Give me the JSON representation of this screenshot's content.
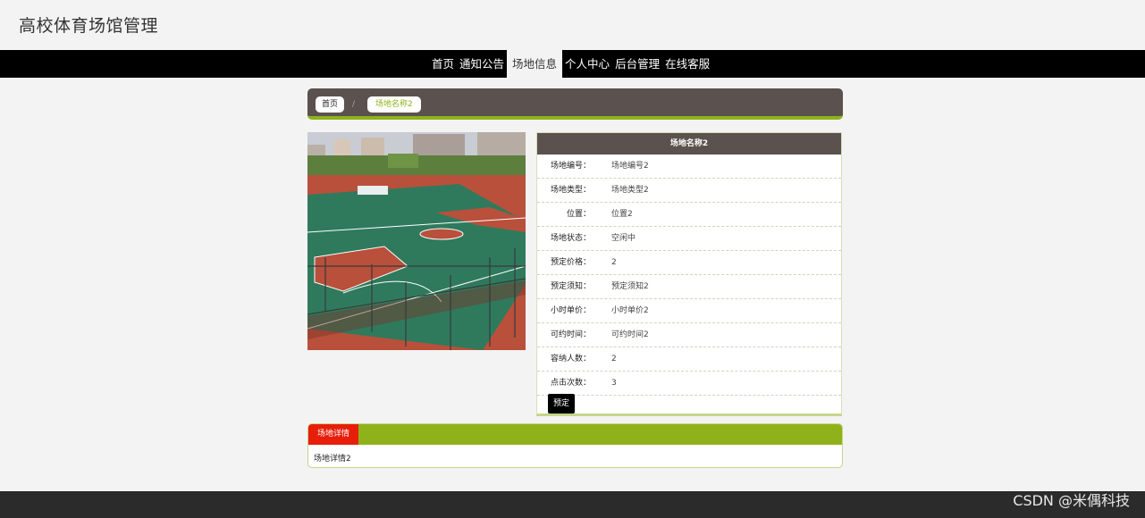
{
  "site": {
    "title": "高校体育场馆管理"
  },
  "nav": {
    "items": [
      {
        "label": "首页"
      },
      {
        "label": "通知公告"
      },
      {
        "label": "场地信息"
      },
      {
        "label": "个人中心"
      },
      {
        "label": "后台管理"
      },
      {
        "label": "在线客服"
      }
    ],
    "active_index": 2
  },
  "breadcrumb": {
    "home": "首页",
    "separator": "/",
    "current": "场地名称2"
  },
  "venue": {
    "title": "场地名称2",
    "fields": [
      {
        "label": "场地编号：",
        "value": "场地编号2"
      },
      {
        "label": "场地类型：",
        "value": "场地类型2"
      },
      {
        "label": "位置：",
        "value": "位置2"
      },
      {
        "label": "场地状态：",
        "value": "空闲中"
      },
      {
        "label": "预定价格：",
        "value": "2"
      },
      {
        "label": "预定须知：",
        "value": "预定须知2"
      },
      {
        "label": "小时单价：",
        "value": "小时单价2"
      },
      {
        "label": "可约时间：",
        "value": "可约时间2"
      },
      {
        "label": "容纳人数：",
        "value": "2"
      },
      {
        "label": "点击次数：",
        "value": "3"
      }
    ],
    "book_label": "预定"
  },
  "detail": {
    "tab_label": "场地详情",
    "content": "场地详情2"
  },
  "watermark": "CSDN @米偶科技",
  "colors": {
    "nav_bg": "#000000",
    "panel_header": "#5b514e",
    "accent_green": "#8fb21a",
    "tab_red": "#e71e09"
  }
}
